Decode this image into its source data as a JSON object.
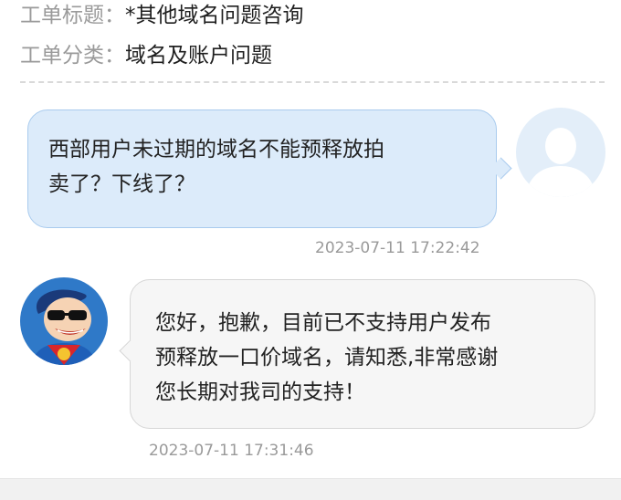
{
  "ticket": {
    "title_label": "工单标题：",
    "title_value": "*其他域名问题咨询",
    "category_label": "工单分类：",
    "category_value": "域名及账户问题"
  },
  "messages": [
    {
      "role": "user",
      "lines": [
        "西部用户未过期的域名不能预释放拍",
        "卖了？下线了？"
      ],
      "time": "2023-07-11 17:22:42"
    },
    {
      "role": "support",
      "lines": [
        "您好，抱歉，目前已不支持用户发布",
        "预释放一口价域名，请知悉,非常感谢",
        "您长期对我司的支持！"
      ],
      "time": "2023-07-11 17:31:46"
    }
  ],
  "colors": {
    "user_bubble": "#dcebfa",
    "user_bubble_border": "#a9cbee",
    "support_bubble": "#f6f6f6",
    "muted_text": "#9a9a9a"
  },
  "icons": {
    "user_avatar": "default-user-avatar-icon",
    "support_avatar": "support-agent-cartoon-avatar"
  }
}
